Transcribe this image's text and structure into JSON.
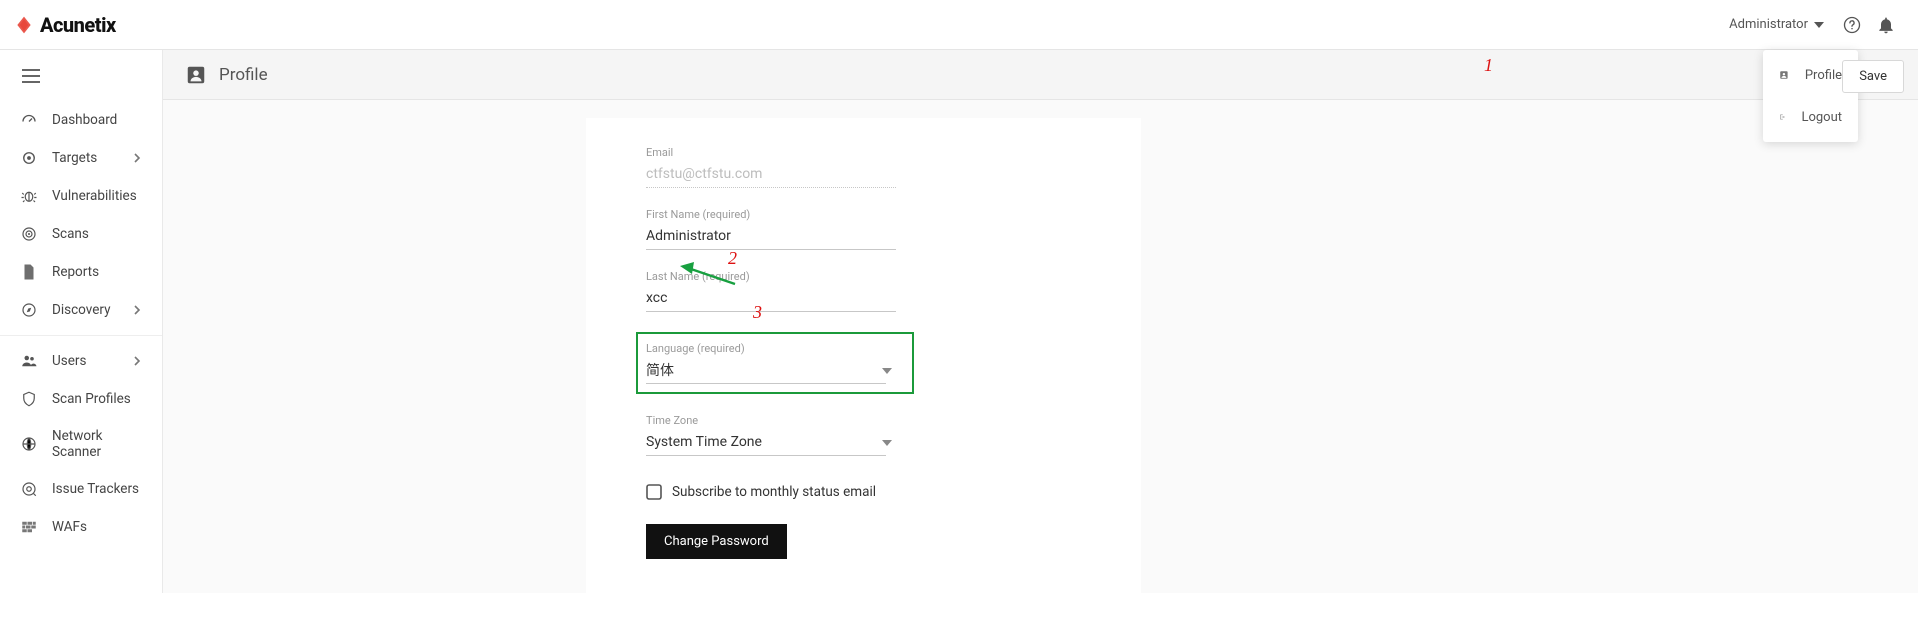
{
  "app": {
    "brand": "Acunetix"
  },
  "header": {
    "user_label": "Administrator",
    "help_icon": "help-icon",
    "bell_icon": "bell-icon"
  },
  "sidebar": {
    "items": [
      {
        "label": "Dashboard",
        "icon": "gauge-icon",
        "submenu": false
      },
      {
        "label": "Targets",
        "icon": "target-icon",
        "submenu": true
      },
      {
        "label": "Vulnerabilities",
        "icon": "bug-icon",
        "submenu": false
      },
      {
        "label": "Scans",
        "icon": "radar-icon",
        "submenu": false
      },
      {
        "label": "Reports",
        "icon": "file-icon",
        "submenu": false
      },
      {
        "label": "Discovery",
        "icon": "compass-icon",
        "submenu": true
      },
      {
        "label": "Users",
        "icon": "users-icon",
        "submenu": true
      },
      {
        "label": "Scan Profiles",
        "icon": "shield-icon",
        "submenu": false
      },
      {
        "label": "Network Scanner",
        "icon": "network-icon",
        "submenu": false
      },
      {
        "label": "Issue Trackers",
        "icon": "tracker-icon",
        "submenu": false
      },
      {
        "label": "WAFs",
        "icon": "waf-icon",
        "submenu": false
      }
    ],
    "separator_after_index": 5
  },
  "page": {
    "title": "Profile",
    "save_label": "Save"
  },
  "dropdown": {
    "items": [
      {
        "label": "Profile",
        "icon": "person-icon"
      },
      {
        "label": "Logout",
        "icon": "logout-icon"
      }
    ]
  },
  "form": {
    "email": {
      "label": "Email",
      "value": "ctfstu@ctfstu.com"
    },
    "first_name": {
      "label": "First Name (required)",
      "value": "Administrator"
    },
    "last_name": {
      "label": "Last Name (required)",
      "value": "xcc"
    },
    "language": {
      "label": "Language (required)",
      "value": "简体"
    },
    "timezone": {
      "label": "Time Zone",
      "value": "System Time Zone"
    },
    "subscribe": {
      "label": "Subscribe to monthly status email",
      "checked": false
    },
    "change_password_label": "Change Password"
  },
  "annotations": {
    "n1": "1",
    "n2": "2",
    "n3": "3"
  }
}
